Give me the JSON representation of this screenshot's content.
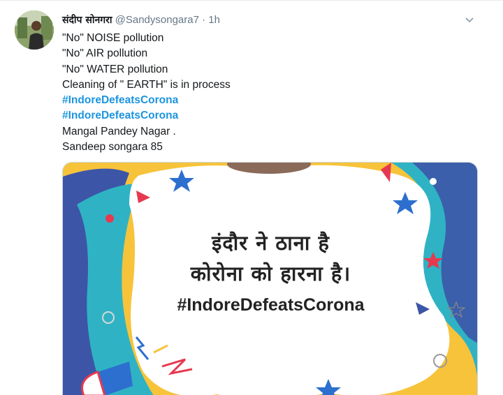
{
  "tweet": {
    "display_name": "संदीप सोनगरा",
    "handle": "@Sandysongara7",
    "separator": " · ",
    "time": "1h",
    "lines": [
      "\"No\" NOISE pollution",
      "\"No\" AIR pollution",
      "\"No\" WATER pollution",
      "Cleaning of \" EARTH\"  is in process"
    ],
    "hashtags": [
      "#IndoreDefeatsCorona",
      "#IndoreDefeatsCorona"
    ],
    "tail_lines": [
      "Mangal Pandey Nagar .",
      "Sandeep songara 85"
    ]
  },
  "media": {
    "line1": "इंदौर ने ठाना है",
    "line2": "कोरोना को हारना है।",
    "hashtag": "#IndoreDefeatsCorona"
  },
  "icons": {
    "avatar": "profile-photo",
    "caret": "chevron-down-icon"
  },
  "colors": {
    "hashtag": "#1b95e0",
    "muted": "#657786",
    "poster_yellow": "#f7c33a",
    "poster_blue": "#3d55a7",
    "poster_teal": "#2fb3c4",
    "poster_red": "#e63950"
  }
}
